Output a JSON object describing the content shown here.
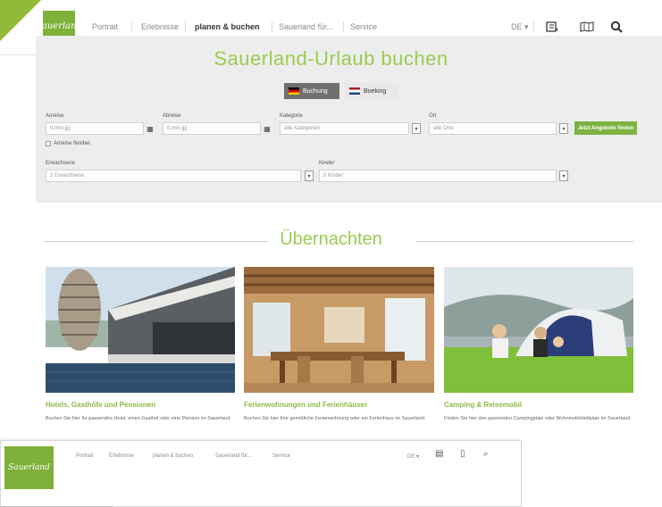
{
  "nav": {
    "logo_text": "Sauerland",
    "items": [
      "Portrait",
      "Erlebnisse",
      "planen & buchen",
      "Sauerland für...",
      "Service"
    ],
    "active_index": 2,
    "language": "DE",
    "tool_icons": [
      "notepad-icon",
      "map-icon",
      "search-icon"
    ]
  },
  "booking": {
    "title": "Sauerland-Urlaub buchen",
    "tabs": [
      {
        "label": "Buchung",
        "selected": true
      },
      {
        "label": "Boeking",
        "selected": false
      }
    ],
    "fields": {
      "arrival": {
        "label": "Anreise",
        "placeholder": "tt.mm.jjjj"
      },
      "departure": {
        "label": "Abreise",
        "placeholder": "tt.mm.jjjj"
      },
      "category": {
        "label": "Kategorie",
        "value": "alle Kategorien"
      },
      "location": {
        "label": "Ort",
        "value": "alle Orte"
      },
      "flexible": {
        "label": "Anreise flexibel"
      },
      "guests": {
        "label": "Erwachsene",
        "value": "2 Erwachsene"
      },
      "children": {
        "label": "Kinder",
        "value": "0 Kinder"
      }
    },
    "search_label": "Jetzt Angebote finden"
  },
  "overnight": {
    "title": "Übernachten",
    "cards": [
      {
        "title": "Hotels, Gasthöfe und Pensionen",
        "text": "Buchen Sie hier Ihr passendes Hotel, einen Gasthof oder eine Pension im Sauerland."
      },
      {
        "title": "Ferienwohnungen und Ferienhäuser",
        "text": "Buchen Sie hier Ihre gemütliche Ferienwohnung oder ein Ferienhaus im Sauerland."
      },
      {
        "title": "Camping & Reisemobil",
        "text": "Finden Sie hier den passenden Campingplatz oder Wohnmobilstellplatz im Sauerland."
      }
    ]
  },
  "overlay_nav": {
    "logo_text": "Sauerland",
    "items": [
      "Portrait",
      "Erlebnisse",
      "planen & buchen",
      "Sauerland für...",
      "Service"
    ],
    "language": "DE"
  }
}
